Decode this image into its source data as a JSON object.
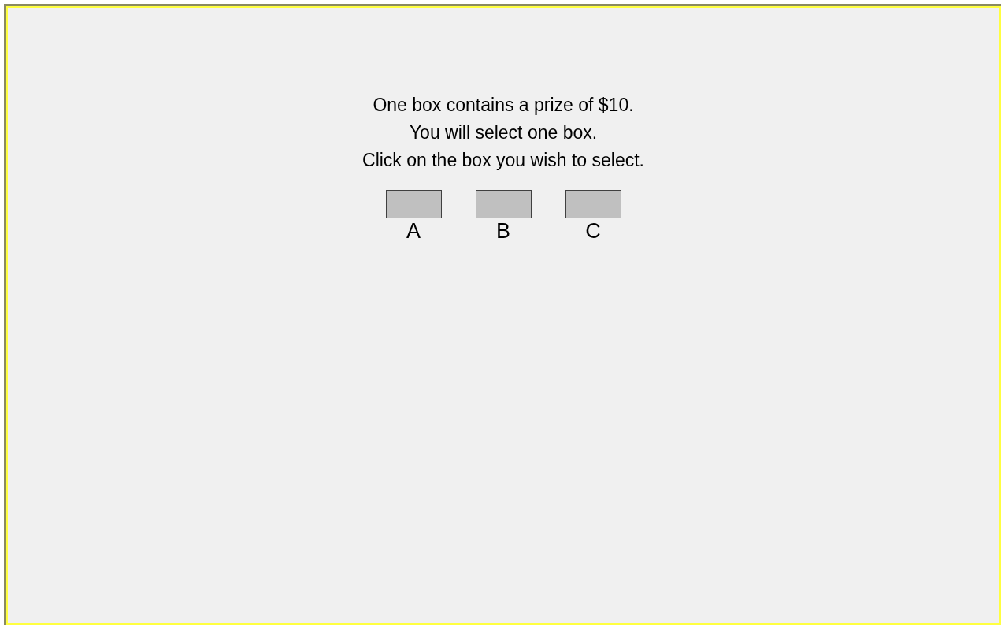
{
  "instructions": [
    "One box contains a prize of $10.",
    "You will select one box.",
    "Click on the box you wish to select."
  ],
  "boxes": [
    {
      "label": "A"
    },
    {
      "label": "B"
    },
    {
      "label": "C"
    }
  ]
}
